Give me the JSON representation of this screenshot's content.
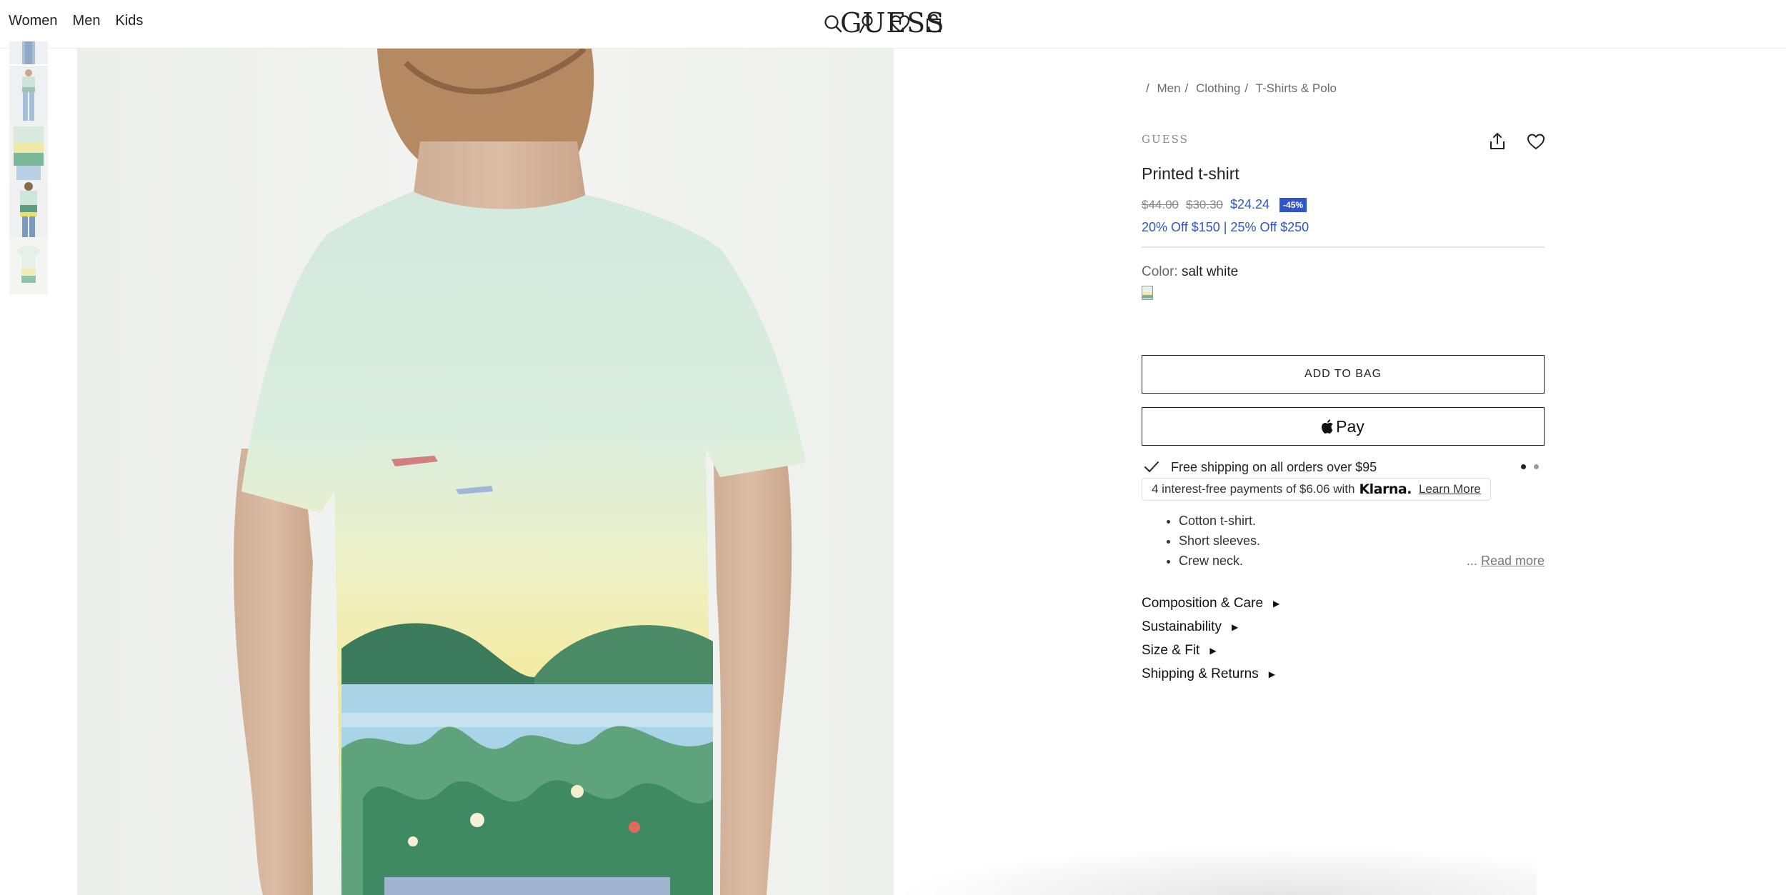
{
  "header": {
    "nav": [
      "Women",
      "Men",
      "Kids"
    ],
    "logo": "GUESS",
    "icons": [
      "search-icon",
      "account-icon",
      "wishlist-icon",
      "bag-icon"
    ]
  },
  "thumbnails": [
    {
      "name": "thumb-front-partial"
    },
    {
      "name": "thumb-full-outfit"
    },
    {
      "name": "thumb-front-detail"
    },
    {
      "name": "thumb-back-view"
    },
    {
      "name": "thumb-flat-lay"
    }
  ],
  "breadcrumb": [
    "Men",
    "Clothing",
    "T-Shirts & Polo"
  ],
  "product": {
    "brand": "GUESS",
    "title": "Printed t-shirt",
    "price_original": "$44.00",
    "price_previous": "$30.30",
    "price_sale": "$24.24",
    "discount_badge": "-45%",
    "promo": "20% Off $150 | 25% Off $250",
    "color_label": "Color:",
    "color_value": "salt white",
    "add_to_bag": "ADD TO BAG",
    "pay_label": "Pay",
    "shipping_text": "Free shipping on all orders over $95",
    "klarna_text": "4 interest-free payments of $6.06 with",
    "klarna_brand": "Klarna.",
    "klarna_link": "Learn More",
    "bullets": [
      "Cotton t-shirt.",
      "Short sleeves.",
      "Crew neck."
    ],
    "read_more_prefix": "...",
    "read_more": "Read more",
    "accordion": [
      "Composition & Care",
      "Sustainability",
      "Size & Fit",
      "Shipping & Returns"
    ]
  },
  "colors": {
    "sale_blue": "#2f56c8",
    "text_dark": "#222222",
    "text_muted": "#888888"
  }
}
